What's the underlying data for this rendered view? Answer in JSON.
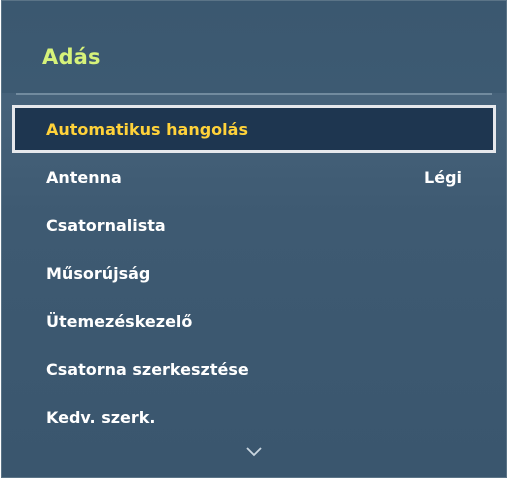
{
  "panel": {
    "title": "Adás",
    "title_color": "#d6f27a",
    "selected_color": "#ffd23a",
    "background_color": "#3e5a72"
  },
  "menu": {
    "items": [
      {
        "label": "Automatikus hangolás",
        "value": "",
        "selected": true
      },
      {
        "label": "Antenna",
        "value": "Légi",
        "selected": false
      },
      {
        "label": "Csatornalista",
        "value": "",
        "selected": false
      },
      {
        "label": "Műsorújság",
        "value": "",
        "selected": false
      },
      {
        "label": "Ütemezéskezelő",
        "value": "",
        "selected": false
      },
      {
        "label": "Csatorna szerkesztése",
        "value": "",
        "selected": false
      },
      {
        "label": "Kedv. szerk.",
        "value": "",
        "selected": false
      }
    ]
  },
  "icons": {
    "scroll_down": "chevron-down-icon"
  }
}
